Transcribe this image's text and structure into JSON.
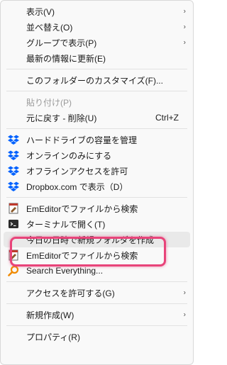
{
  "menu": {
    "group1": [
      {
        "label": "表示(V)",
        "arrow": "›"
      },
      {
        "label": "並べ替え(O)",
        "arrow": "›"
      },
      {
        "label": "グループで表示(P)",
        "arrow": "›"
      },
      {
        "label": "最新の情報に更新(E)"
      }
    ],
    "group2": [
      {
        "label": "このフォルダーのカスタマイズ(F)..."
      }
    ],
    "group3": [
      {
        "label": "貼り付け(P)"
      },
      {
        "label": "元に戻す - 削除(U)",
        "shortcut": "Ctrl+Z"
      }
    ],
    "group4": [
      {
        "label": "ハードドライブの容量を管理"
      },
      {
        "label": "オンラインのみにする"
      },
      {
        "label": "オフラインアクセスを許可"
      },
      {
        "label": "Dropbox.com で表示（D）"
      }
    ],
    "group5": [
      {
        "label": "EmEditorでファイルから検索"
      },
      {
        "label": "ターミナルで開く(T)"
      },
      {
        "label": "今日の日時で新規フォルダを作成"
      },
      {
        "label": "EmEditorでファイルから検索"
      },
      {
        "label": "Search Everything..."
      }
    ],
    "group6": [
      {
        "label": "アクセスを許可する(G)",
        "arrow": "›"
      }
    ],
    "group7": [
      {
        "label": "新規作成(W)",
        "arrow": "›"
      }
    ],
    "group8": [
      {
        "label": "プロパティ(R)"
      }
    ]
  },
  "icons": {
    "dropbox_color": "#0061fe",
    "search_everything_color": "#f08a00",
    "highlight_color": "#e8447a"
  }
}
